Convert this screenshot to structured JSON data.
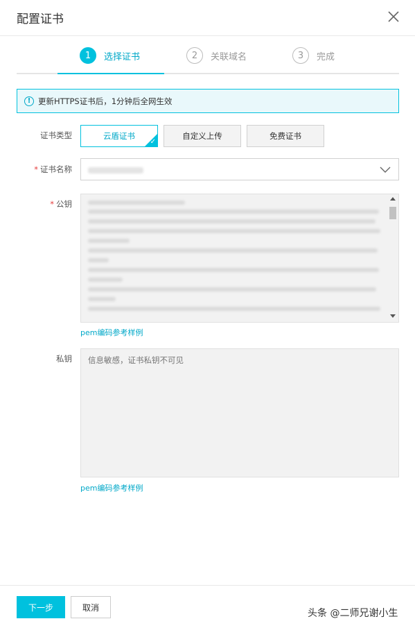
{
  "dialog": {
    "title": "配置证书"
  },
  "steps": [
    {
      "num": "1",
      "label": "选择证书"
    },
    {
      "num": "2",
      "label": "关联域名"
    },
    {
      "num": "3",
      "label": "完成"
    }
  ],
  "notice": {
    "text": "更新HTTPS证书后，1分钟后全网生效"
  },
  "cert_type": {
    "label": "证书类型",
    "options": [
      "云盾证书",
      "自定义上传",
      "免费证书"
    ],
    "selected": "云盾证书"
  },
  "cert_name": {
    "label": "证书名称",
    "required_mark": "*"
  },
  "public_key": {
    "label": "公钥",
    "required_mark": "*",
    "sample_link": "pem编码参考样例"
  },
  "private_key": {
    "label": "私钥",
    "placeholder": "信息敏感，证书私钥不可见",
    "sample_link": "pem编码参考样例"
  },
  "footer": {
    "next_label": "下一步",
    "cancel_label": "取消"
  },
  "watermark": "头条 @二师兄谢小生",
  "colors": {
    "accent": "#00c1de",
    "accent_text": "#00a8c8",
    "notice_bg": "#e9f8fb",
    "required": "#e53e3e"
  }
}
